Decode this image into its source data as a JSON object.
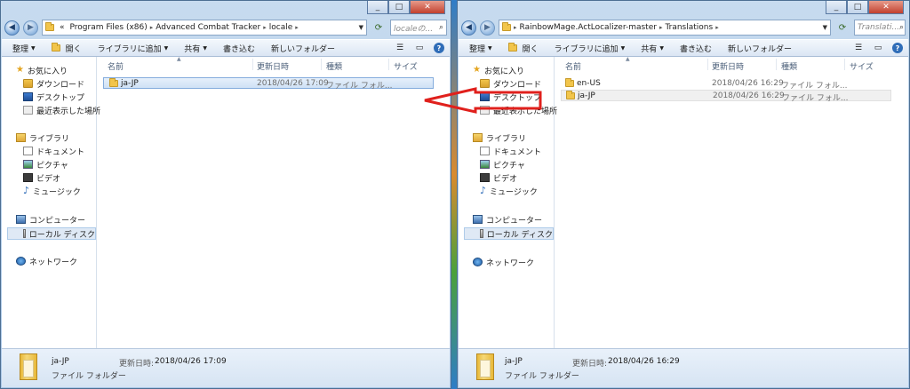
{
  "colors": {
    "annotation_arrow": "#e0201c",
    "accent": "#2f6db8"
  },
  "left": {
    "address": {
      "prefix": "«",
      "segments": [
        "Program Files (x86)",
        "Advanced Combat Tracker",
        "locale"
      ]
    },
    "search_placeholder": "localeの...",
    "toolbar": [
      "整理",
      "開く",
      "ライブラリに追加",
      "共有",
      "書き込む",
      "新しいフォルダー"
    ],
    "nav": {
      "favorites": "お気に入り",
      "downloads": "ダウンロード",
      "desktop": "デスクトップ",
      "recent": "最近表示した場所",
      "libraries": "ライブラリ",
      "documents": "ドキュメント",
      "pictures": "ピクチャ",
      "videos": "ビデオ",
      "music": "ミュージック",
      "computer": "コンピューター",
      "localdisk": "ローカル ディスク",
      "network": "ネットワーク"
    },
    "columns": {
      "name": "名前",
      "date": "更新日時",
      "type": "種類",
      "size": "サイズ"
    },
    "files": [
      {
        "name": "ja-JP",
        "date": "2018/04/26 17:09",
        "type": "ファイル フォル..."
      }
    ],
    "details": {
      "name": "ja-JP",
      "type": "ファイル フォルダー",
      "date_label": "更新日時:",
      "date_value": "2018/04/26 17:09"
    }
  },
  "right": {
    "address": {
      "segments": [
        "RainbowMage.ActLocalizer-master",
        "Translations"
      ]
    },
    "search_placeholder": "Translati...",
    "toolbar": [
      "整理",
      "開く",
      "ライブラリに追加",
      "共有",
      "書き込む",
      "新しいフォルダー"
    ],
    "nav": {
      "favorites": "お気に入り",
      "downloads": "ダウンロード",
      "desktop": "デスクトップ",
      "recent": "最近表示した場所",
      "libraries": "ライブラリ",
      "documents": "ドキュメント",
      "pictures": "ピクチャ",
      "videos": "ビデオ",
      "music": "ミュージック",
      "computer": "コンピューター",
      "localdisk": "ローカル ディスク",
      "network": "ネットワーク"
    },
    "columns": {
      "name": "名前",
      "date": "更新日時",
      "type": "種類",
      "size": "サイズ"
    },
    "files": [
      {
        "name": "en-US",
        "date": "2018/04/26 16:29",
        "type": "ファイル フォル..."
      },
      {
        "name": "ja-JP",
        "date": "2018/04/26 16:29",
        "type": "ファイル フォル..."
      }
    ],
    "details": {
      "name": "ja-JP",
      "type": "ファイル フォルダー",
      "date_label": "更新日時:",
      "date_value": "2018/04/26 16:29"
    }
  }
}
